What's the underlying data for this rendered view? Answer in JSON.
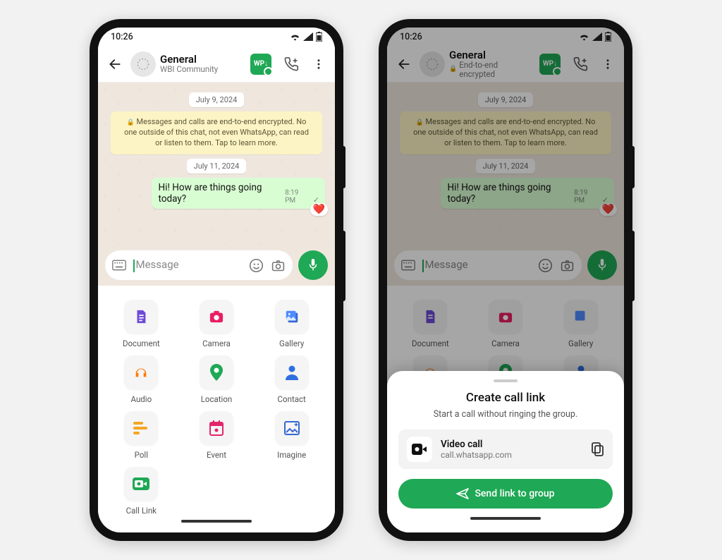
{
  "status": {
    "time": "10:26"
  },
  "header": {
    "title": "General",
    "subtitle_a": "WBI Community",
    "subtitle_b": "End-to-end encrypted",
    "badge": "WP↓"
  },
  "chat": {
    "date1": "July 9, 2024",
    "e2e_notice": "Messages and calls are end-to-end encrypted. No one outside of this chat, not even WhatsApp, can read or listen to them. Tap to learn more.",
    "date2": "July 11, 2024",
    "msg1": {
      "text": "Hi! How are things going today?",
      "time": "8:19 PM",
      "reaction": "❤️"
    }
  },
  "input": {
    "placeholder": "Message"
  },
  "attach": {
    "items": [
      {
        "label": "Document"
      },
      {
        "label": "Camera"
      },
      {
        "label": "Gallery"
      },
      {
        "label": "Audio"
      },
      {
        "label": "Location"
      },
      {
        "label": "Contact"
      },
      {
        "label": "Poll"
      },
      {
        "label": "Event"
      },
      {
        "label": "Imagine"
      },
      {
        "label": "Call Link"
      }
    ]
  },
  "sheet": {
    "title": "Create call link",
    "subtitle": "Start a call without ringing the group.",
    "link_title": "Video call",
    "link_url": "call.whatsapp.com",
    "send_label": "Send link to group"
  }
}
